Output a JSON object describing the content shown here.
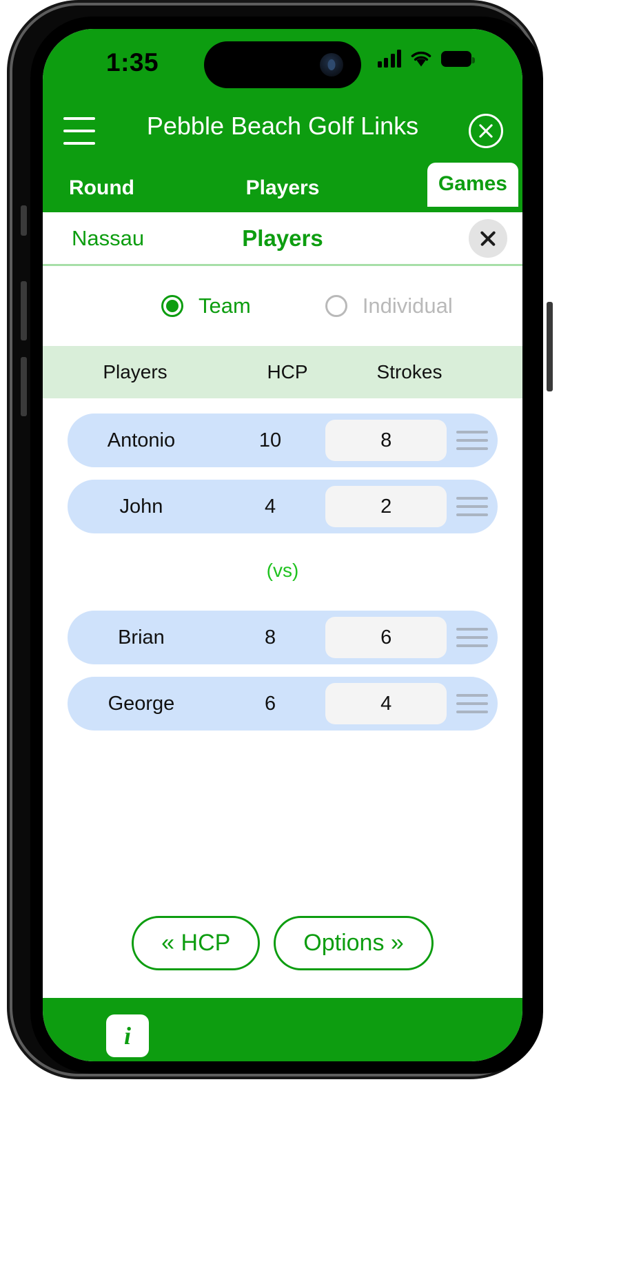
{
  "status_bar": {
    "time": "1:35",
    "signal_icon": "cellular-signal-icon",
    "wifi_icon": "wifi-icon",
    "battery_icon": "battery-icon"
  },
  "header": {
    "menu_icon": "hamburger-menu-icon",
    "title": "Pebble Beach Golf Links",
    "close_icon": "circled-close-icon"
  },
  "tabs": [
    {
      "label": "Round",
      "active": false
    },
    {
      "label": "Players",
      "active": false
    },
    {
      "label": "Games",
      "active": true
    }
  ],
  "sub_header": {
    "back_label": "Nassau",
    "title": "Players",
    "close_icon": "close-icon"
  },
  "mode_selector": {
    "options": [
      {
        "label": "Team",
        "selected": true
      },
      {
        "label": "Individual",
        "selected": false
      }
    ]
  },
  "table": {
    "columns": [
      "Players",
      "HCP",
      "Strokes"
    ],
    "team_a": [
      {
        "name": "Antonio",
        "hcp": "10",
        "strokes": "8",
        "handle_icon": "drag-handle-icon"
      },
      {
        "name": "John",
        "hcp": "4",
        "strokes": "2",
        "handle_icon": "drag-handle-icon"
      }
    ],
    "versus_label": "(vs)",
    "team_b": [
      {
        "name": "Brian",
        "hcp": "8",
        "strokes": "6",
        "handle_icon": "drag-handle-icon"
      },
      {
        "name": "George",
        "hcp": "6",
        "strokes": "4",
        "handle_icon": "drag-handle-icon"
      }
    ]
  },
  "bottom_actions": {
    "hcp_label": "« HCP",
    "options_label": "Options »"
  },
  "footer": {
    "info_label": "i"
  },
  "colors": {
    "brand_green": "#0d9d10",
    "row_blue": "#cfe2fb",
    "header_green_tint": "#d9eed9",
    "muted_gray": "#b9b9b9"
  }
}
